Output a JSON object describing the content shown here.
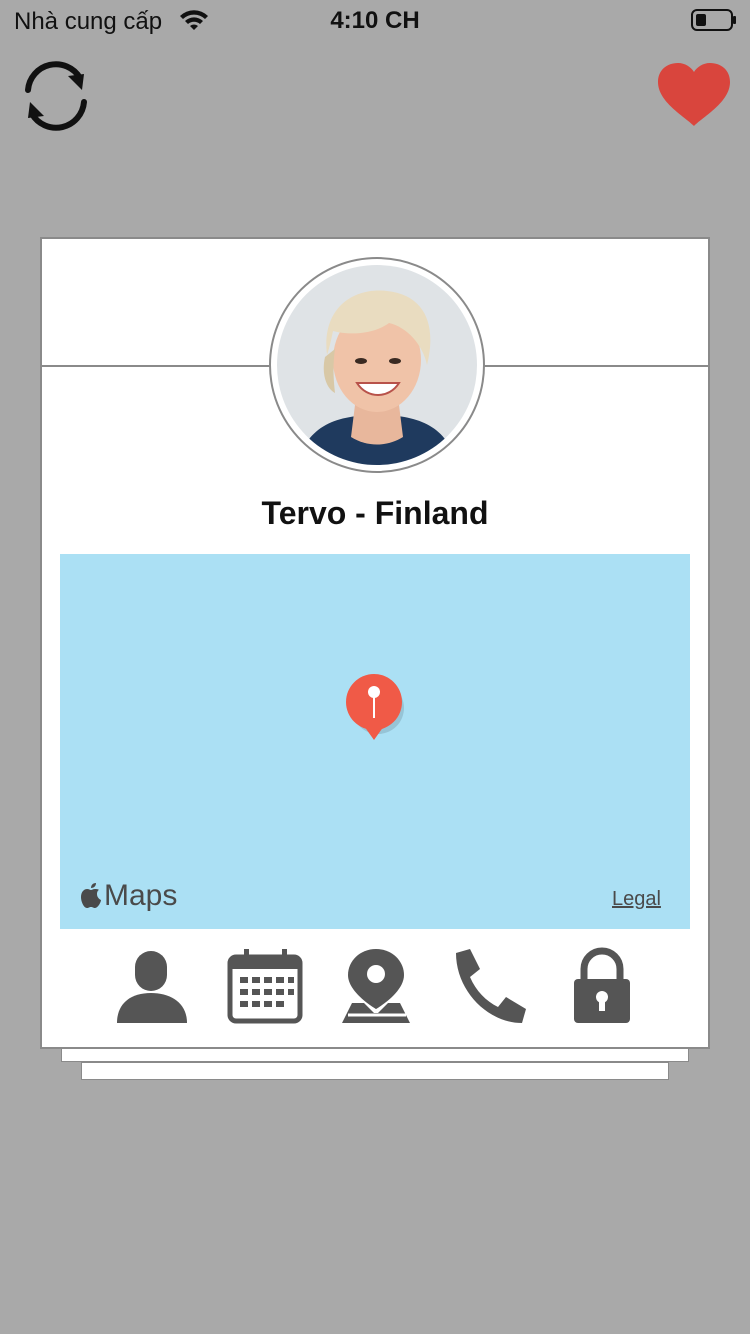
{
  "status_bar": {
    "carrier": "Nhà cung cấp",
    "time": "4:10 CH"
  },
  "toolbar": {
    "refresh_icon": "refresh-icon",
    "favorite_icon": "heart-icon",
    "favorite_color": "#d9453d"
  },
  "profile": {
    "name": "Tervo - Finland"
  },
  "map": {
    "brand": "Maps",
    "legal": "Legal",
    "pin_color": "#f05a47",
    "water_color": "#abe0f4"
  },
  "actions": [
    {
      "icon": "person-icon"
    },
    {
      "icon": "calendar-icon"
    },
    {
      "icon": "map-pin-icon"
    },
    {
      "icon": "phone-icon"
    },
    {
      "icon": "lock-icon"
    }
  ]
}
